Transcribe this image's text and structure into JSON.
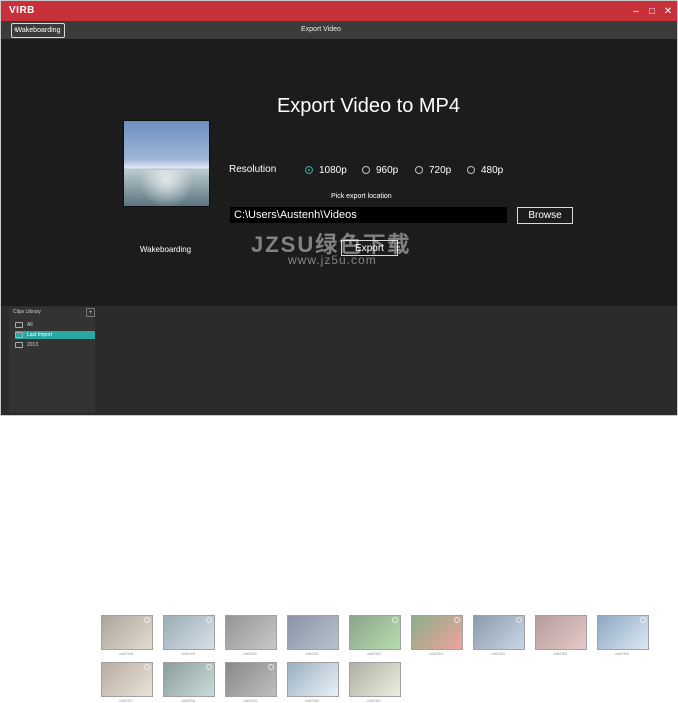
{
  "window": {
    "brand": "VIRB",
    "controls": [
      "–",
      "□",
      "✕"
    ]
  },
  "nav": {
    "back_label": "Wakeboarding",
    "title": "Export Video"
  },
  "main": {
    "heading": "Export Video to MP4",
    "thumbnail_caption": "Wakeboarding",
    "resolution": {
      "label": "Resolution",
      "options": [
        "1080p",
        "960p",
        "720p",
        "480p"
      ],
      "selected": "1080p"
    },
    "location": {
      "label": "Pick export location",
      "path": "C:\\Users\\Austenh\\Videos",
      "browse_label": "Browse"
    },
    "export_label": "Export",
    "watermark": {
      "line1": "JZSU绿色下载",
      "line2": "www.jz5u.com"
    }
  },
  "library": {
    "title": "Clips Library",
    "add_icon": "plus-icon",
    "items": [
      "All",
      "Last Import",
      "2013"
    ],
    "selected": "Last Import"
  },
  "clips": [
    {
      "name": "vid0048",
      "has_pin": true
    },
    {
      "name": "vid0049",
      "has_pin": true
    },
    {
      "name": "vid0050",
      "has_pin": false
    },
    {
      "name": "vid0051",
      "has_pin": false
    },
    {
      "name": "vid0052",
      "has_pin": true
    },
    {
      "name": "vid0053",
      "has_pin": true
    },
    {
      "name": "vid0054",
      "has_pin": true
    },
    {
      "name": "vid0055",
      "has_pin": false
    },
    {
      "name": "vid0056",
      "has_pin": true
    },
    {
      "name": "vid0057",
      "has_pin": true
    },
    {
      "name": "vid0058",
      "has_pin": true
    },
    {
      "name": "vid0059",
      "has_pin": true
    },
    {
      "name": "vid0060",
      "has_pin": false
    },
    {
      "name": "vid0061",
      "has_pin": false
    }
  ],
  "colors": {
    "titlebar": "#c8313a",
    "accent": "#2aa6a3"
  }
}
